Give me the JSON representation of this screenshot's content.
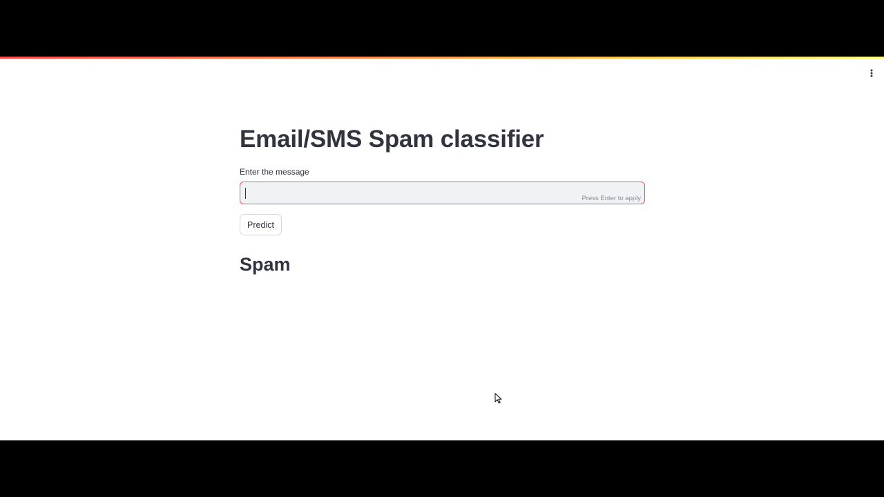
{
  "app": {
    "title": "Email/SMS Spam classifier",
    "accent_color": "#ff4b4b",
    "menu_icon": "vertical-ellipsis-icon"
  },
  "input": {
    "label": "Enter the message",
    "value": "",
    "hint": "Press Enter to apply"
  },
  "predict_button": {
    "label": "Predict"
  },
  "result": {
    "text": "Spam"
  }
}
